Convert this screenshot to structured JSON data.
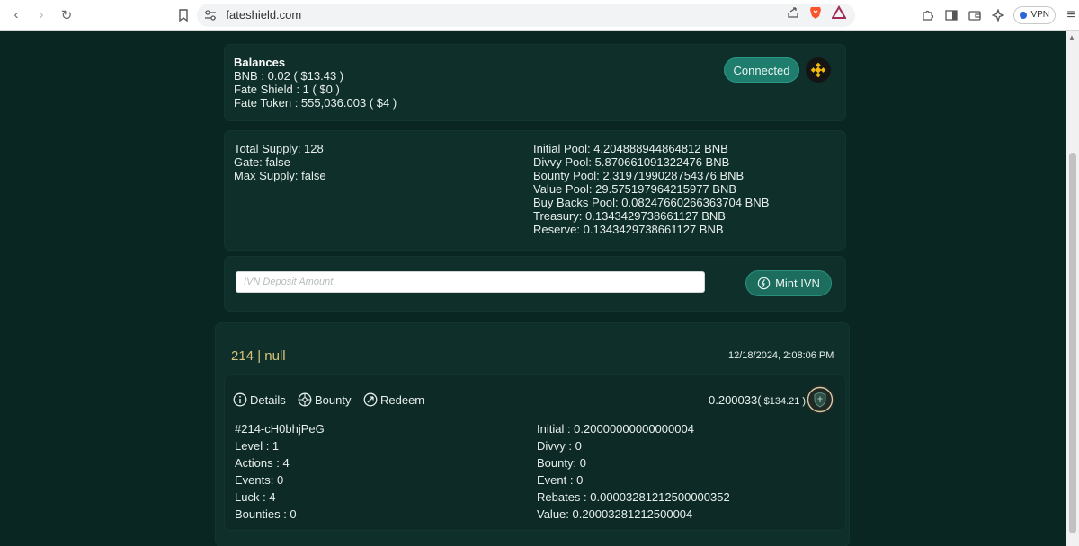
{
  "browser": {
    "url": "fateshield.com",
    "vpn_label": "VPN"
  },
  "balances": {
    "title": "Balances",
    "lines": [
      "BNB : 0.02 ( $13.43 )",
      "Fate Shield : 1 ( $0 )",
      "Fate Token : 555,036.003 ( $4 )"
    ],
    "connected_label": "Connected"
  },
  "supply": {
    "left": [
      "Total Supply: 128",
      "Gate: false",
      "Max Supply: false"
    ],
    "right": [
      "Initial Pool: 4.204888944864812 BNB",
      "Divvy Pool: 5.870661091322476 BNB",
      "Bounty Pool: 2.3197199028754376 BNB",
      "Value Pool: 29.575197964215977 BNB",
      "Buy Backs Pool: 0.08247660266363704 BNB",
      "Treasury: 0.1343429738661127 BNB",
      "Reserve: 0.1343429738661127 BNB"
    ]
  },
  "mint": {
    "placeholder": "IVN Deposit Amount",
    "button_label": "Mint IVN"
  },
  "nft": {
    "title": "214 | null",
    "date": "12/18/2024, 2:08:06 PM",
    "actions": {
      "details": "Details",
      "bounty": "Bounty",
      "redeem": "Redeem"
    },
    "value_main": "0.200033(",
    "value_usd": " $134.21 )",
    "left_stats": [
      "#214-cH0bhjPeG",
      "Level : 1",
      "Actions : 4",
      "Events: 0",
      "Luck : 4",
      "Bounties : 0"
    ],
    "right_stats": [
      "Initial : 0.20000000000000004",
      "Divvy : 0",
      "Bounty: 0",
      "Event : 0",
      "Rebates : 0.00003281212500000352",
      "Value: 0.20003281212500004"
    ]
  },
  "colors": {
    "page_bg": "#092622",
    "panel_bg": "#0f2f2a",
    "accent_green": "#1e7d6c",
    "title_gold": "#d8c57b"
  }
}
